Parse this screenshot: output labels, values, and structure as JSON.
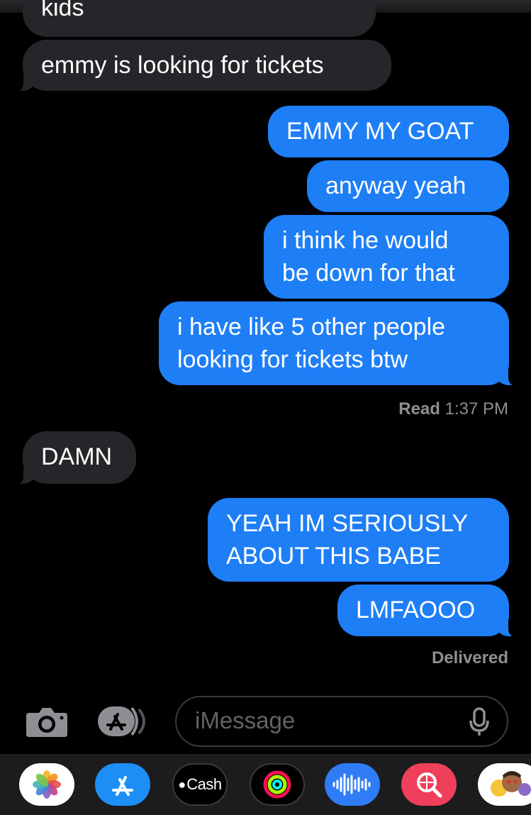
{
  "messages": [
    {
      "id": "m0",
      "text": "kids",
      "dir": "in"
    },
    {
      "id": "m1",
      "text": "emmy is looking for tickets",
      "dir": "in"
    },
    {
      "id": "m2",
      "text": "EMMY MY GOAT",
      "dir": "out"
    },
    {
      "id": "m3",
      "text": "anyway yeah",
      "dir": "out"
    },
    {
      "id": "m4a",
      "text": "i think he would",
      "dir": "out"
    },
    {
      "id": "m4b",
      "text": "be down for that",
      "dir": "out"
    },
    {
      "id": "m5a",
      "text": "i have like 5 other people",
      "dir": "out"
    },
    {
      "id": "m5b",
      "text": "looking for tickets btw",
      "dir": "out"
    },
    {
      "id": "m6",
      "text": "DAMN",
      "dir": "in"
    },
    {
      "id": "m7a",
      "text": "YEAH IM SERIOUSLY",
      "dir": "out"
    },
    {
      "id": "m7b",
      "text": "ABOUT THIS BABE",
      "dir": "out"
    },
    {
      "id": "m8",
      "text": "LMFAOOO",
      "dir": "out"
    }
  ],
  "status": {
    "read_label": "Read",
    "read_time": "1:37 PM",
    "delivered": "Delivered"
  },
  "compose": {
    "placeholder": "iMessage",
    "camera_icon": "camera-icon",
    "apps_icon": "app-store-icon",
    "mic_icon": "microphone-icon"
  },
  "app_tray": {
    "items": [
      {
        "name": "photos-app-icon"
      },
      {
        "name": "app-store-app-icon"
      },
      {
        "name": "apple-cash-app-icon",
        "label": "Cash"
      },
      {
        "name": "activity-app-icon"
      },
      {
        "name": "audio-message-app-icon"
      },
      {
        "name": "image-search-app-icon"
      },
      {
        "name": "memoji-app-icon"
      }
    ]
  },
  "colors": {
    "outgoing": "#1e7ef6",
    "incoming": "#26262a",
    "background": "#000000"
  }
}
